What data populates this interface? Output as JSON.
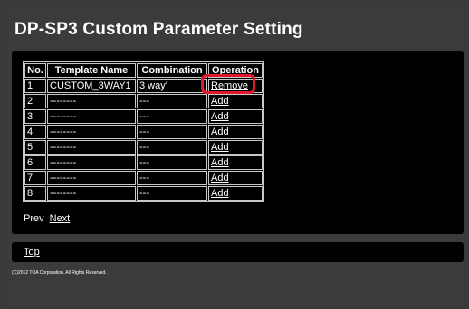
{
  "page": {
    "title": "DP-SP3 Custom Parameter Setting"
  },
  "table": {
    "headers": {
      "no": "No.",
      "name": "Template Name",
      "combination": "Combination",
      "operation": "Operation"
    },
    "rows": [
      {
        "no": "1",
        "name": "CUSTOM_3WAY1",
        "combination": "3 way'",
        "operation": "Remove"
      },
      {
        "no": "2",
        "name": "--------",
        "combination": "---",
        "operation": "Add"
      },
      {
        "no": "3",
        "name": "--------",
        "combination": "---",
        "operation": "Add"
      },
      {
        "no": "4",
        "name": "--------",
        "combination": "---",
        "operation": "Add"
      },
      {
        "no": "5",
        "name": "--------",
        "combination": "---",
        "operation": "Add"
      },
      {
        "no": "6",
        "name": "--------",
        "combination": "---",
        "operation": "Add"
      },
      {
        "no": "7",
        "name": "--------",
        "combination": "---",
        "operation": "Add"
      },
      {
        "no": "8",
        "name": "--------",
        "combination": "---",
        "operation": "Add"
      }
    ]
  },
  "pager": {
    "prev": "Prev",
    "next": "Next"
  },
  "footer": {
    "top_link": "Top",
    "copyright": "(C)2012 TOA Corporation. All Rights Reserved."
  },
  "colors": {
    "highlight": "#e0182f",
    "panel": "#000000",
    "background": "#3b3b3b"
  }
}
